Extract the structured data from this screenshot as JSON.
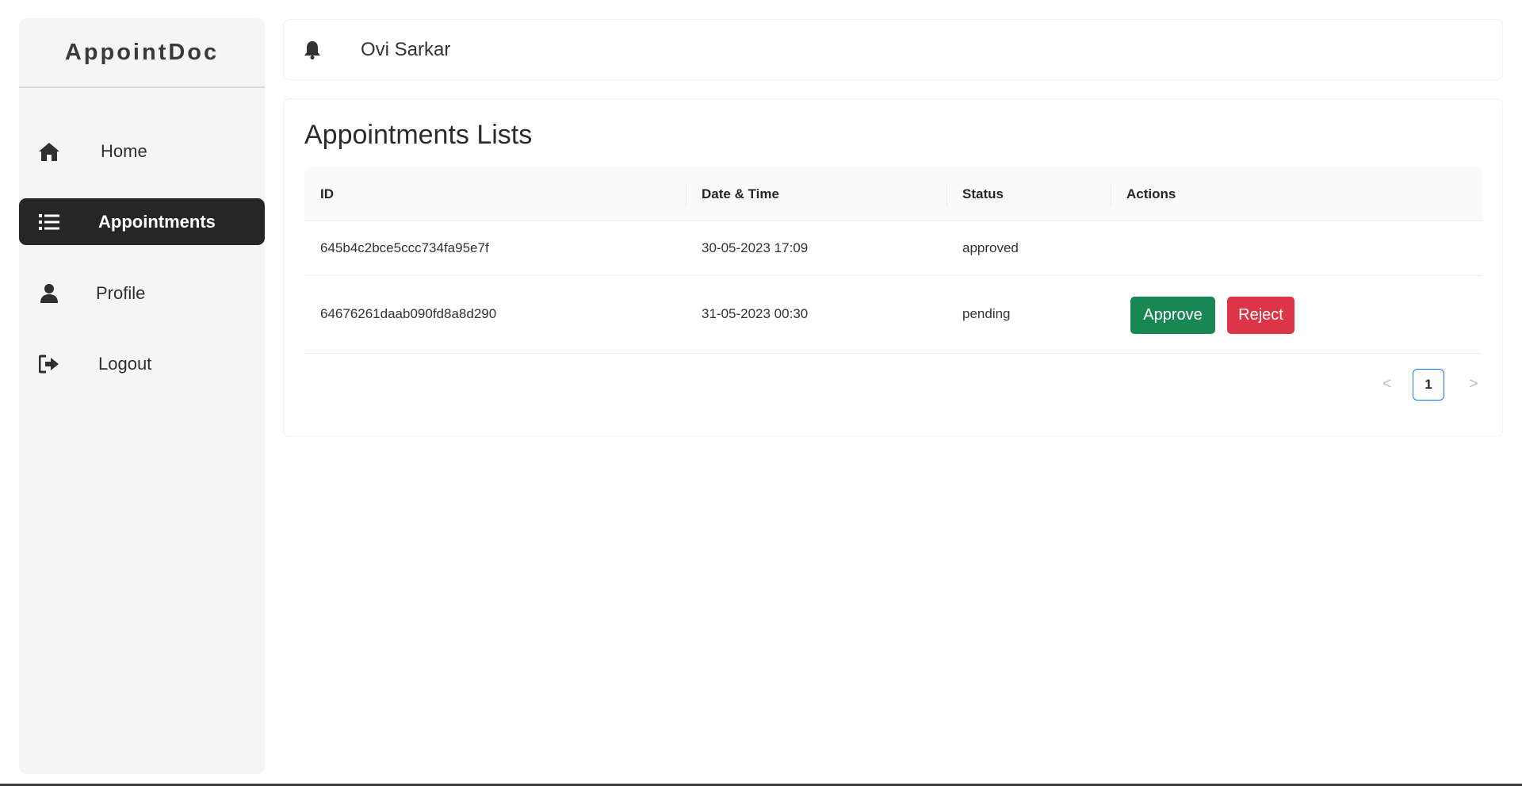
{
  "brand": "AppointDoc",
  "sidebar": {
    "items": [
      {
        "label": "Home",
        "icon": "home-icon"
      },
      {
        "label": "Appointments",
        "icon": "list-icon",
        "active": true
      },
      {
        "label": "Profile",
        "icon": "user-icon"
      },
      {
        "label": "Logout",
        "icon": "logout-icon"
      }
    ]
  },
  "header": {
    "notification_icon": "bell-icon",
    "user_name": "Ovi Sarkar"
  },
  "main": {
    "title": "Appointments Lists",
    "table": {
      "columns": [
        "ID",
        "Date & Time",
        "Status",
        "Actions"
      ],
      "rows": [
        {
          "id": "645b4c2bce5ccc734fa95e7f",
          "datetime": "30-05-2023  17:09",
          "status": "approved",
          "actions": []
        },
        {
          "id": "64676261daab090fd8a8d290",
          "datetime": "31-05-2023  00:30",
          "status": "pending",
          "actions": [
            "Approve",
            "Reject"
          ]
        }
      ]
    },
    "pagination": {
      "prev": "<",
      "current_page": "1",
      "next": ">"
    }
  },
  "colors": {
    "approve": "#198754",
    "reject": "#dc3545",
    "active_nav": "#262626",
    "page_border": "#1677ff"
  }
}
